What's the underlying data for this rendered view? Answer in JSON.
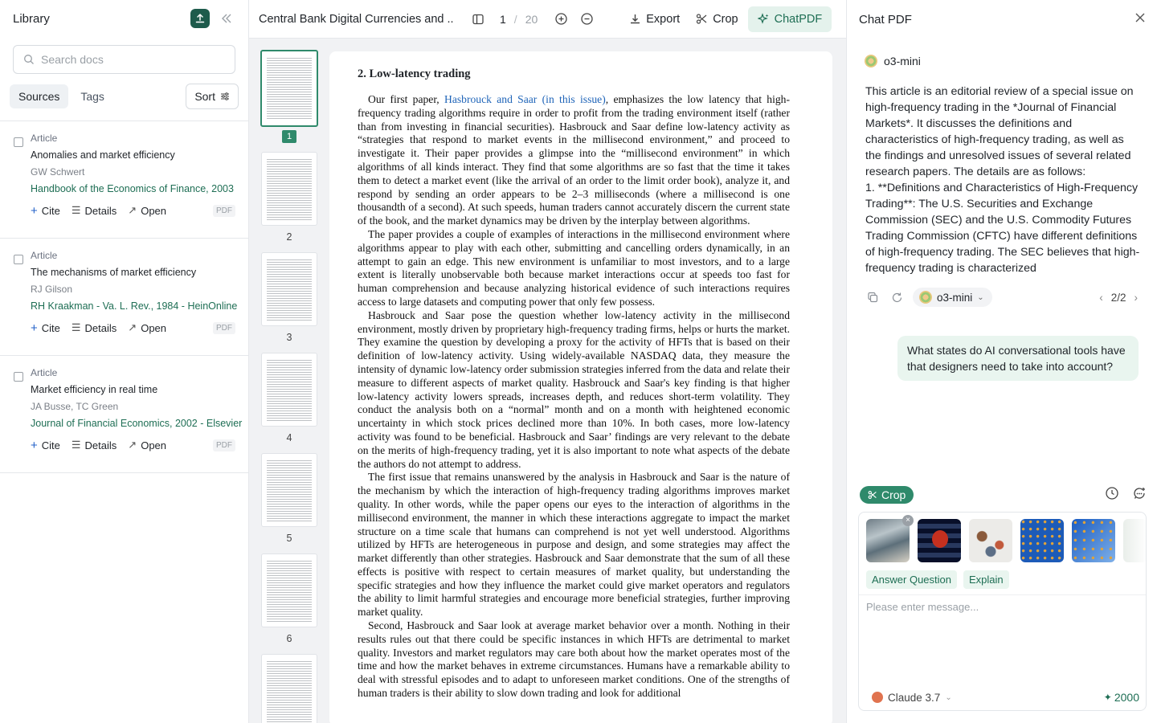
{
  "library": {
    "title": "Library",
    "search_placeholder": "Search docs",
    "tabs": [
      {
        "label": "Sources"
      },
      {
        "label": "Tags"
      }
    ],
    "sort_label": "Sort",
    "entries": [
      {
        "type": "Article",
        "title": "Anomalies and market efficiency",
        "authors": "GW Schwert",
        "source": "Handbook of the Economics of Finance, 2003",
        "cite": "Cite",
        "details": "Details",
        "open": "Open",
        "badge": "PDF"
      },
      {
        "type": "Article",
        "title": "The mechanisms of market efficiency",
        "authors": "RJ Gilson",
        "source": "RH Kraakman - Va. L. Rev., 1984 - HeinOnline",
        "cite": "Cite",
        "details": "Details",
        "open": "Open",
        "badge": "PDF"
      },
      {
        "type": "Article",
        "title": "Market efficiency in real time",
        "authors": "JA Busse, TC Green",
        "source": "Journal of Financial Economics, 2002 - Elsevier",
        "cite": "Cite",
        "details": "Details",
        "open": "Open",
        "badge": "PDF"
      }
    ]
  },
  "viewer": {
    "doc_title": "Central Bank Digital Currencies and ..",
    "current_page": "1",
    "separator": "/",
    "total_pages": "20",
    "export_label": "Export",
    "crop_label": "Crop",
    "chatpdf_label": "ChatPDF",
    "thumbnail_labels": [
      "1",
      "2",
      "3",
      "4",
      "5",
      "6"
    ],
    "page": {
      "heading": "2.  Low-latency trading",
      "p1_lead": "Our first paper, ",
      "p1_link": "Hasbrouck and Saar (in this issue)",
      "p1_rest": ", emphasizes the low latency that high-frequency trading algorithms require in order to profit from the trading environment itself (rather than from investing in financial securities). Hasbrouck and Saar define low-latency activity as “strategies that respond to market events in the millisecond environment,” and proceed to investigate it. Their paper provides a glimpse into the “millisecond environment” in which algorithms of all kinds interact. They find that some algorithms are so fast that the time it takes them to detect a market event (like the arrival of an order to the limit order book), analyze it, and respond by sending an order appears to be 2–3 milliseconds (where a millisecond is one thousandth of a second). At such speeds, human traders cannot accurately discern the current state of the book, and the market dynamics may be driven by the interplay between algorithms.",
      "p2": "The paper provides a couple of examples of interactions in the millisecond environment where algorithms appear to play with each other, submitting and cancelling orders dynamically, in an attempt to gain an edge. This new environment is unfamiliar to most investors, and to a large extent is literally unobservable both because market interactions occur at speeds too fast for human comprehension and because analyzing historical evidence of such interactions requires access to large datasets and computing power that only few possess.",
      "p3": "Hasbrouck and Saar pose the question whether low-latency activity in the millisecond environment, mostly driven by proprietary high-frequency trading firms, helps or hurts the market. They examine the question by developing a proxy for the activity of HFTs that is based on their definition of low-latency activity. Using widely-available NASDAQ data, they measure the intensity of dynamic low-latency order submission strategies inferred from the data and relate their measure to different aspects of market quality. Hasbrouck and Saar's key finding is that higher low-latency activity lowers spreads, increases depth, and reduces short-term volatility. They conduct the analysis both on a “normal” month and on a month with heightened economic uncertainty in which stock prices declined more than 10%. In both cases, more low-latency activity was found to be beneficial. Hasbrouck and Saar’ findings are very relevant to the debate on the merits of high-frequency trading, yet it is also important to note what aspects of the debate the authors do not attempt to address.",
      "p4": "The first issue that remains unanswered by the analysis in Hasbrouck and Saar is the nature of the mechanism by which the interaction of high-frequency trading algorithms improves market quality. In other words, while the paper opens our eyes to the interaction of algorithms in the millisecond environment, the manner in which these interactions aggregate to impact the market structure on a time scale that humans can comprehend is not yet well understood. Algorithms utilized by HFTs are heterogeneous in purpose and design, and some strategies may affect the market differently than other strategies. Hasbrouck and Saar demonstrate that the sum of all these effects is positive with respect to certain measures of market quality, but understanding the specific strategies and how they influence the market could give market operators and regulators the ability to limit harmful strategies and encourage more beneficial strategies, further improving market quality.",
      "p5": "Second, Hasbrouck and Saar look at average market behavior over a month. Nothing in their results rules out that there could be specific instances in which HFTs are detrimental to market quality. Investors and market regulators may care both about how the market operates most of the time and how the market behaves in extreme circumstances. Humans have a remarkable ability to deal with stressful episodes and to adapt to unforeseen market conditions. One of the strengths of human traders is their ability to slow down trading and look for additional"
    }
  },
  "chat": {
    "title": "Chat PDF",
    "model_name": "o3-mini",
    "answer": "This article is an editorial review of a special issue on high-frequency trading in the *Journal of Financial Markets*. It discusses the definitions and characteristics of high-frequency trading, as well as the findings and unresolved issues of several related research papers. The details are as follows:\n1. **Definitions and Characteristics of High-Frequency Trading**: The U.S. Securities and Exchange Commission (SEC) and the U.S. Commodity Futures Trading Commission (CFTC) have different definitions of high-frequency trading. The SEC believes that high-frequency trading is characterized",
    "answer_model": "o3-mini",
    "pager": "2/2",
    "user_message": "What states do AI conversational tools have that designers need to take into account?",
    "crop_chip": "Crop",
    "quick_actions": [
      "Answer Question",
      "Explain"
    ],
    "input_placeholder": "Please enter message...",
    "bottom_model": "Claude 3.7",
    "credits": "2000",
    "colors": {
      "accent": "#2f8a6b",
      "brand_dark": "#1e5b4c",
      "link": "#1d63b8"
    }
  }
}
